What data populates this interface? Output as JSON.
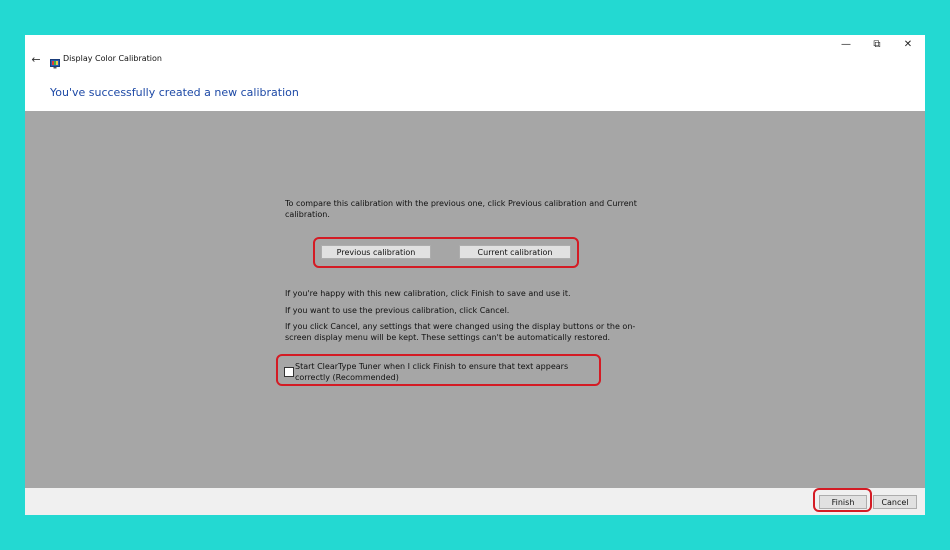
{
  "window": {
    "app_title": "Display Color Calibration",
    "back_icon": "back-arrow-icon",
    "controls": {
      "minimize": "—",
      "maximize": "⧉",
      "close": "✕"
    }
  },
  "page": {
    "heading": "You've successfully created a new calibration",
    "compare_text": "To compare this calibration with the previous one, click Previous calibration and Current calibration.",
    "previous_button": "Previous calibration",
    "current_button": "Current calibration",
    "happy_text": "If you're happy with this new calibration, click Finish to save and use it.",
    "previous_text": "If you want to use the previous calibration, click Cancel.",
    "cancel_note": "If you click Cancel, any settings that were changed using the display buttons or the on-screen display menu will be kept. These settings can't be automatically restored.",
    "cleartype_label": "Start ClearType Tuner when I click Finish to ensure that text appears correctly (Recommended)",
    "cleartype_checked": false
  },
  "footer": {
    "finish_button": "Finish",
    "cancel_button": "Cancel"
  },
  "colors": {
    "background": "#23d9d2",
    "content_gray": "#a6a6a6",
    "heading_blue": "#1d49a6",
    "highlight_red": "#d41b24"
  }
}
